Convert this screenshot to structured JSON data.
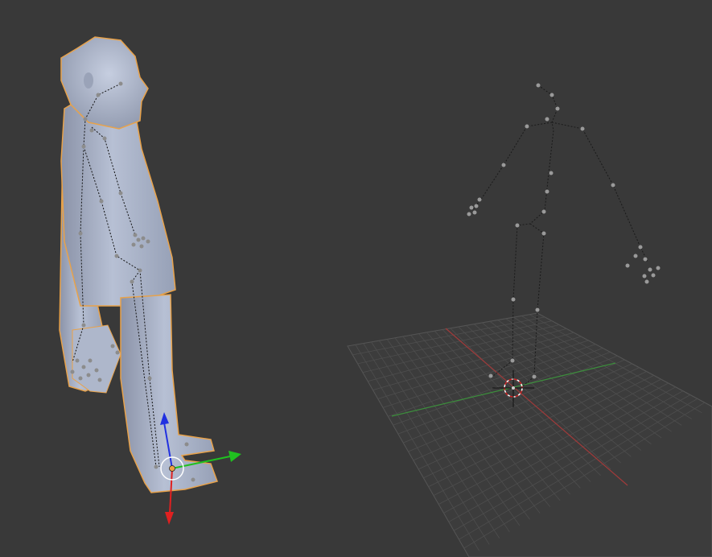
{
  "colors": {
    "background": "#393939",
    "grid_line": "#505050",
    "axis_x": "#a03a3a",
    "axis_y": "#3c8f3c",
    "selection_outline": "#e8a24a",
    "mesh_light": "#b9c2d6",
    "mesh_shadow": "#7c8498",
    "bone_joint": "#9a9a9a",
    "gizmo_x": "#e02020",
    "gizmo_y": "#20c020",
    "gizmo_z": "#2030e0"
  },
  "icons": {
    "cursor": "3d-cursor-icon",
    "gizmo": "transform-gizmo-icon",
    "origin": "object-origin-icon"
  }
}
